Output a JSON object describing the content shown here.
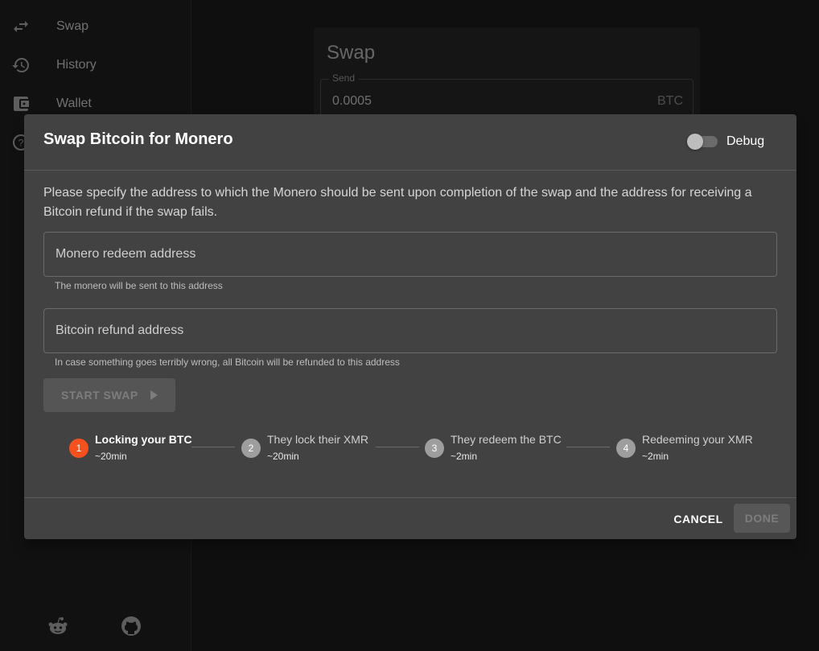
{
  "sidebar": {
    "items": [
      {
        "label": "Swap",
        "icon": "swap-arrows-icon"
      },
      {
        "label": "History",
        "icon": "history-icon"
      },
      {
        "label": "Wallet",
        "icon": "wallet-icon"
      },
      {
        "label": "",
        "icon": "help-icon"
      }
    ],
    "social": [
      {
        "icon": "reddit-icon"
      },
      {
        "icon": "github-icon"
      }
    ]
  },
  "main": {
    "title": "Swap",
    "send": {
      "legend": "Send",
      "value": "0.0005",
      "unit": "BTC"
    }
  },
  "dialog": {
    "title": "Swap Bitcoin for Monero",
    "debug_label": "Debug",
    "debug_enabled": false,
    "description": "Please specify the address to which the Monero should be sent upon completion of the swap and the address for receiving a Bitcoin refund if the swap fails.",
    "monero_field": {
      "placeholder": "Monero redeem address",
      "value": "",
      "helper": "The monero will be sent to this address"
    },
    "bitcoin_field": {
      "placeholder": "Bitcoin refund address",
      "value": "",
      "helper": "In case something goes terribly wrong, all Bitcoin will be refunded to this address"
    },
    "start_button": "START SWAP",
    "steps": [
      {
        "number": "1",
        "name": "Locking your BTC",
        "duration": "~20min",
        "active": true
      },
      {
        "number": "2",
        "name": "They lock their XMR",
        "duration": "~20min",
        "active": false
      },
      {
        "number": "3",
        "name": "They redeem the BTC",
        "duration": "~2min",
        "active": false
      },
      {
        "number": "4",
        "name": "Redeeming your XMR",
        "duration": "~2min",
        "active": false
      }
    ],
    "cancel_button": "CANCEL",
    "done_button": "DONE"
  },
  "colors": {
    "active_step": "#f4511e",
    "inactive_step": "#9e9e9e",
    "dialog_bg": "#424242",
    "page_bg": "#1e1e1e"
  }
}
